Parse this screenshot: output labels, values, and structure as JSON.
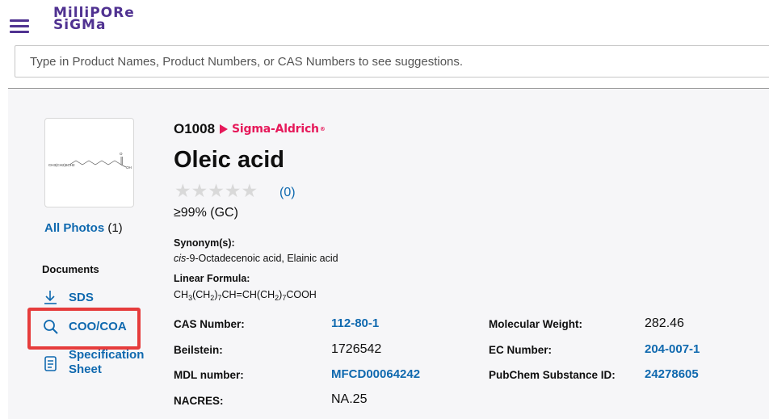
{
  "header": {
    "menu_icon": "hamburger-menu-icon",
    "logo_line1": "MilliPORe",
    "logo_line2": "SiGMa",
    "brand_color": "#503291"
  },
  "search": {
    "placeholder": "Type in Product Names, Product Numbers, or CAS Numbers to see suggestions."
  },
  "product": {
    "number": "O1008",
    "brand": "Sigma-Aldrich",
    "brand_mark": "®",
    "name": "Oleic acid",
    "stars": "★★★★★",
    "rating_value": 0,
    "reviews": "(0)",
    "purity": "≥99% (GC)",
    "synonyms_label": "Synonym(s):",
    "synonyms_italic": "cis",
    "synonyms_rest": "-9-Octadecenoic acid, Elainic acid",
    "linear_formula_label": "Linear Formula:",
    "linear_formula": "CH3(CH2)7CH=CH(CH2)7COOH",
    "structure_chain_text": "CH3(CH2)6CH2",
    "structure_oxygen": "O",
    "structure_oh": "OH"
  },
  "sidebar": {
    "all_photos_label": "All Photos",
    "all_photos_count": "(1)",
    "documents_title": "Documents",
    "sds_label": "SDS",
    "sds_icon": "download-arrow-icon",
    "coa_label": "COO/COA",
    "coa_icon": "search-icon",
    "spec_label_line1": "Specification",
    "spec_label_line2": "Sheet",
    "spec_icon": "document-icon",
    "highlight_color": "#e63c3c"
  },
  "properties": {
    "cas_label": "CAS Number:",
    "cas_value": "112-80-1",
    "beilstein_label": "Beilstein:",
    "beilstein_value": "1726542",
    "mdl_label": "MDL number:",
    "mdl_value": "MFCD00064242",
    "nacres_label": "NACRES:",
    "nacres_value": "NA.25",
    "mw_label": "Molecular Weight:",
    "mw_value": "282.46",
    "ec_label": "EC Number:",
    "ec_value": "204-007-1",
    "pubchem_label": "PubChem Substance ID:",
    "pubchem_value": "24278605"
  },
  "colors": {
    "link": "#0f69af",
    "brand_sigma": "#e6195a",
    "panel_bg": "#f6f6f8"
  }
}
